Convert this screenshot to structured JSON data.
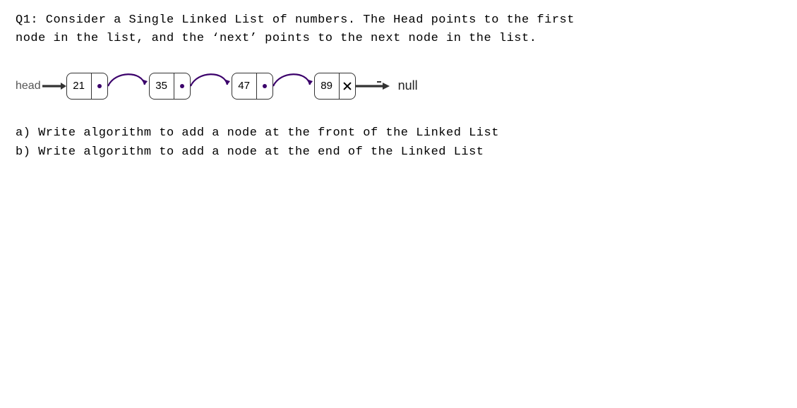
{
  "question": {
    "line1": "Q1: Consider a Single Linked List of numbers. The Head points to the first",
    "line2": "node in the list, and the ‘next’ points to the next node in the list."
  },
  "diagram": {
    "head_label": "head",
    "null_label": "null",
    "nodes": [
      {
        "value": "21"
      },
      {
        "value": "35"
      },
      {
        "value": "47"
      },
      {
        "value": "89"
      }
    ]
  },
  "parts": {
    "a": "a) Write algorithm to add a node at the front of the Linked List",
    "b": "b) Write algorithm to add a node at the end of the Linked List"
  },
  "colors": {
    "arc": "#3b006b",
    "arrow": "#333333"
  }
}
